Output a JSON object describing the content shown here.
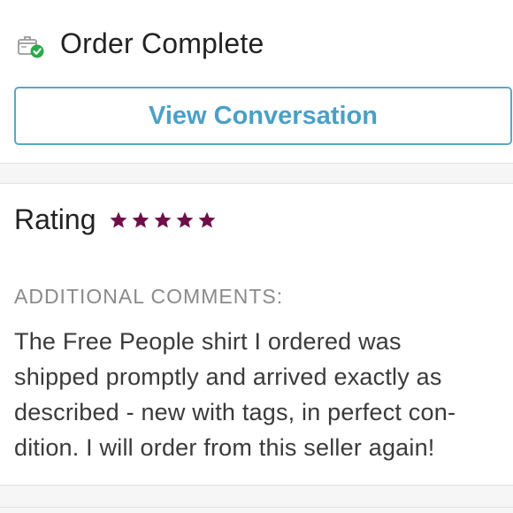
{
  "order": {
    "status_title": "Order Complete",
    "status_icon": "package-check-icon"
  },
  "actions": {
    "view_conversation_label": "View Conversation"
  },
  "rating": {
    "label": "Rating",
    "stars": 5,
    "max_stars": 5,
    "star_color": "#6e0f4a"
  },
  "comments": {
    "label": "ADDITIONAL COMMENTS:",
    "lines": [
      "The Free People shirt I ordered was",
      "shipped promptly and arrived exactly as",
      "described - new with tags, in perfect con-",
      "dition. I will order from this seller again!"
    ]
  },
  "colors": {
    "accent": "#4aa0c6",
    "check_green": "#2aa84a",
    "muted_label": "#8a8a8a"
  }
}
